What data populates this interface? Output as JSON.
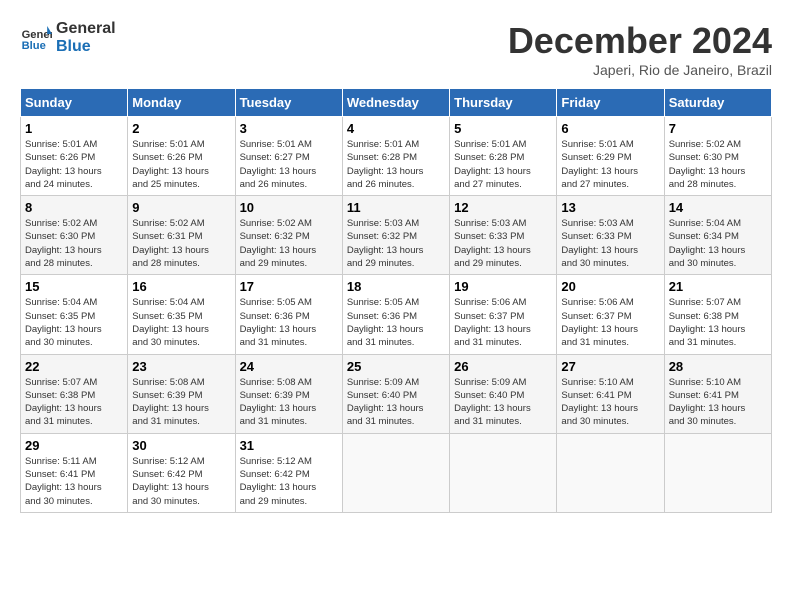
{
  "header": {
    "logo_line1": "General",
    "logo_line2": "Blue",
    "month_title": "December 2024",
    "subtitle": "Japeri, Rio de Janeiro, Brazil"
  },
  "days_of_week": [
    "Sunday",
    "Monday",
    "Tuesday",
    "Wednesday",
    "Thursday",
    "Friday",
    "Saturday"
  ],
  "weeks": [
    [
      {
        "day": "1",
        "info": "Sunrise: 5:01 AM\nSunset: 6:26 PM\nDaylight: 13 hours\nand 24 minutes."
      },
      {
        "day": "2",
        "info": "Sunrise: 5:01 AM\nSunset: 6:26 PM\nDaylight: 13 hours\nand 25 minutes."
      },
      {
        "day": "3",
        "info": "Sunrise: 5:01 AM\nSunset: 6:27 PM\nDaylight: 13 hours\nand 26 minutes."
      },
      {
        "day": "4",
        "info": "Sunrise: 5:01 AM\nSunset: 6:28 PM\nDaylight: 13 hours\nand 26 minutes."
      },
      {
        "day": "5",
        "info": "Sunrise: 5:01 AM\nSunset: 6:28 PM\nDaylight: 13 hours\nand 27 minutes."
      },
      {
        "day": "6",
        "info": "Sunrise: 5:01 AM\nSunset: 6:29 PM\nDaylight: 13 hours\nand 27 minutes."
      },
      {
        "day": "7",
        "info": "Sunrise: 5:02 AM\nSunset: 6:30 PM\nDaylight: 13 hours\nand 28 minutes."
      }
    ],
    [
      {
        "day": "8",
        "info": "Sunrise: 5:02 AM\nSunset: 6:30 PM\nDaylight: 13 hours\nand 28 minutes."
      },
      {
        "day": "9",
        "info": "Sunrise: 5:02 AM\nSunset: 6:31 PM\nDaylight: 13 hours\nand 28 minutes."
      },
      {
        "day": "10",
        "info": "Sunrise: 5:02 AM\nSunset: 6:32 PM\nDaylight: 13 hours\nand 29 minutes."
      },
      {
        "day": "11",
        "info": "Sunrise: 5:03 AM\nSunset: 6:32 PM\nDaylight: 13 hours\nand 29 minutes."
      },
      {
        "day": "12",
        "info": "Sunrise: 5:03 AM\nSunset: 6:33 PM\nDaylight: 13 hours\nand 29 minutes."
      },
      {
        "day": "13",
        "info": "Sunrise: 5:03 AM\nSunset: 6:33 PM\nDaylight: 13 hours\nand 30 minutes."
      },
      {
        "day": "14",
        "info": "Sunrise: 5:04 AM\nSunset: 6:34 PM\nDaylight: 13 hours\nand 30 minutes."
      }
    ],
    [
      {
        "day": "15",
        "info": "Sunrise: 5:04 AM\nSunset: 6:35 PM\nDaylight: 13 hours\nand 30 minutes."
      },
      {
        "day": "16",
        "info": "Sunrise: 5:04 AM\nSunset: 6:35 PM\nDaylight: 13 hours\nand 30 minutes."
      },
      {
        "day": "17",
        "info": "Sunrise: 5:05 AM\nSunset: 6:36 PM\nDaylight: 13 hours\nand 31 minutes."
      },
      {
        "day": "18",
        "info": "Sunrise: 5:05 AM\nSunset: 6:36 PM\nDaylight: 13 hours\nand 31 minutes."
      },
      {
        "day": "19",
        "info": "Sunrise: 5:06 AM\nSunset: 6:37 PM\nDaylight: 13 hours\nand 31 minutes."
      },
      {
        "day": "20",
        "info": "Sunrise: 5:06 AM\nSunset: 6:37 PM\nDaylight: 13 hours\nand 31 minutes."
      },
      {
        "day": "21",
        "info": "Sunrise: 5:07 AM\nSunset: 6:38 PM\nDaylight: 13 hours\nand 31 minutes."
      }
    ],
    [
      {
        "day": "22",
        "info": "Sunrise: 5:07 AM\nSunset: 6:38 PM\nDaylight: 13 hours\nand 31 minutes."
      },
      {
        "day": "23",
        "info": "Sunrise: 5:08 AM\nSunset: 6:39 PM\nDaylight: 13 hours\nand 31 minutes."
      },
      {
        "day": "24",
        "info": "Sunrise: 5:08 AM\nSunset: 6:39 PM\nDaylight: 13 hours\nand 31 minutes."
      },
      {
        "day": "25",
        "info": "Sunrise: 5:09 AM\nSunset: 6:40 PM\nDaylight: 13 hours\nand 31 minutes."
      },
      {
        "day": "26",
        "info": "Sunrise: 5:09 AM\nSunset: 6:40 PM\nDaylight: 13 hours\nand 31 minutes."
      },
      {
        "day": "27",
        "info": "Sunrise: 5:10 AM\nSunset: 6:41 PM\nDaylight: 13 hours\nand 30 minutes."
      },
      {
        "day": "28",
        "info": "Sunrise: 5:10 AM\nSunset: 6:41 PM\nDaylight: 13 hours\nand 30 minutes."
      }
    ],
    [
      {
        "day": "29",
        "info": "Sunrise: 5:11 AM\nSunset: 6:41 PM\nDaylight: 13 hours\nand 30 minutes."
      },
      {
        "day": "30",
        "info": "Sunrise: 5:12 AM\nSunset: 6:42 PM\nDaylight: 13 hours\nand 30 minutes."
      },
      {
        "day": "31",
        "info": "Sunrise: 5:12 AM\nSunset: 6:42 PM\nDaylight: 13 hours\nand 29 minutes."
      },
      {
        "day": "",
        "info": ""
      },
      {
        "day": "",
        "info": ""
      },
      {
        "day": "",
        "info": ""
      },
      {
        "day": "",
        "info": ""
      }
    ]
  ]
}
